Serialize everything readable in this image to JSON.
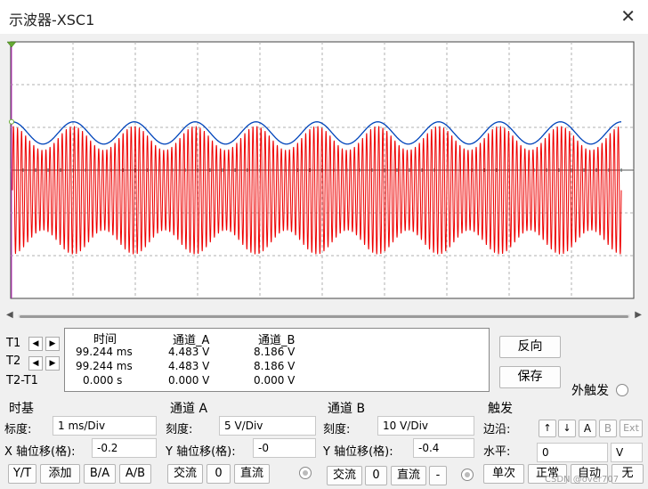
{
  "window": {
    "title": "示波器-XSC1"
  },
  "colors": {
    "background": "#f0f0f0",
    "plot_bg": "#ffffff",
    "grid": "#b0b0b0",
    "channel_a": "#0044bb",
    "channel_b": "#ee0000",
    "cursor1": "#cc33cc",
    "cursor_marker": "#66aa33"
  },
  "readout": {
    "headers": [
      "时间",
      "通道_A",
      "通道_B"
    ],
    "rows": [
      {
        "label": "T1",
        "time": "99.244 ms",
        "a": "4.483 V",
        "b": "8.186 V"
      },
      {
        "label": "T2",
        "time": "99.244 ms",
        "a": "4.483 V",
        "b": "8.186 V"
      },
      {
        "label": "T2-T1",
        "time": "0.000 s",
        "a": "0.000 V",
        "b": "0.000 V"
      }
    ]
  },
  "buttons": {
    "reverse": "反向",
    "save": "保存",
    "ext_trigger": "外触发"
  },
  "timebase": {
    "title": "时基",
    "scale_label": "标度:",
    "scale_value": "1 ms/Div",
    "xpos_label": "X 轴位移(格):",
    "xpos_value": "-0.2",
    "modes": [
      "Y/T",
      "添加",
      "B/A",
      "A/B"
    ]
  },
  "channel_a": {
    "title": "通道 A",
    "scale_label": "刻度:",
    "scale_value": "5  V/Div",
    "ypos_label": "Y 轴位移(格):",
    "ypos_value": "-0",
    "coupling": [
      "交流",
      "0",
      "直流"
    ]
  },
  "channel_b": {
    "title": "通道 B",
    "scale_label": "刻度:",
    "scale_value": "10  V/Div",
    "ypos_label": "Y 轴位移(格):",
    "ypos_value": "-0.4",
    "coupling": [
      "交流",
      "0",
      "直流",
      "-"
    ]
  },
  "trigger": {
    "title": "触发",
    "edge_label": "边沿:",
    "edge_buttons": [
      "↑",
      "↓",
      "A",
      "B",
      "Ext"
    ],
    "level_label": "水平:",
    "level_value": "0",
    "level_unit": "V",
    "modes": [
      "单次",
      "正常",
      "自动",
      "无"
    ]
  },
  "watermark": "CSDN @over707",
  "chart_data": {
    "type": "line",
    "divisions": {
      "x": 10,
      "y": 6
    },
    "time_per_div_ms": 1,
    "series": [
      {
        "channel": "A",
        "kind": "sine",
        "offset_div": 0.87,
        "amplitude_div": 0.26,
        "cycles": 10
      },
      {
        "channel": "B",
        "kind": "am",
        "center_div": -0.47,
        "envelope_mean_div": 1.22,
        "envelope_amp_div": 0.28,
        "envelope_cycles": 10,
        "carrier_cycles": 150
      }
    ]
  }
}
